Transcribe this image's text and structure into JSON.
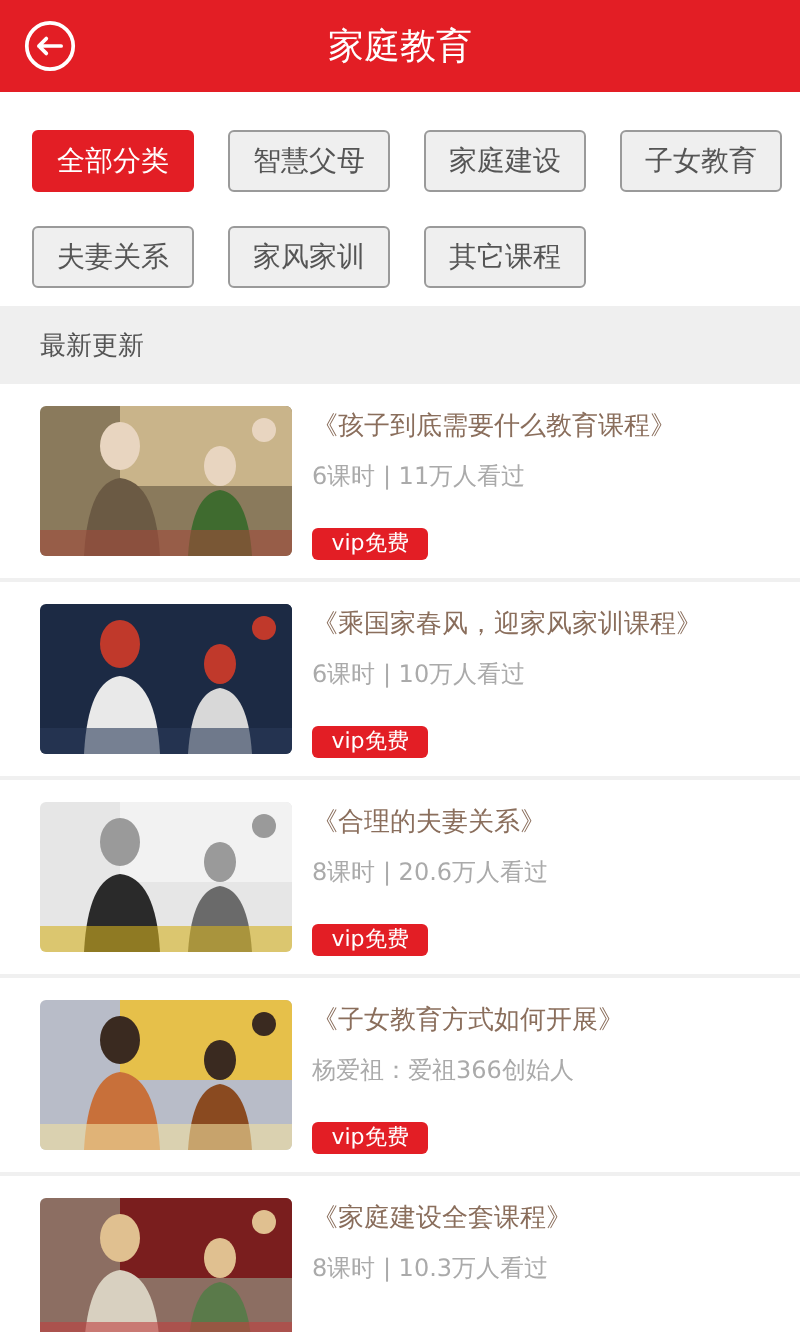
{
  "header": {
    "title": "家庭教育"
  },
  "categories": [
    {
      "label": "全部分类",
      "selected": true
    },
    {
      "label": "智慧父母",
      "selected": false
    },
    {
      "label": "家庭建设",
      "selected": false
    },
    {
      "label": "子女教育",
      "selected": false
    },
    {
      "label": "夫妻关系",
      "selected": false
    },
    {
      "label": "家风家训",
      "selected": false
    },
    {
      "label": "其它课程",
      "selected": false
    }
  ],
  "section": {
    "title": "最新更新"
  },
  "courses": [
    {
      "title": "《孩子到底需要什么教育课程》",
      "meta": "6课时 | 11万人看过",
      "badge": "vip免费"
    },
    {
      "title": "《乘国家春风，迎家风家训课程》",
      "meta": "6课时 | 10万人看过",
      "badge": "vip免费"
    },
    {
      "title": "《合理的夫妻关系》",
      "meta": "8课时 | 20.6万人看过",
      "badge": "vip免费"
    },
    {
      "title": "《子女教育方式如何开展》",
      "meta": "杨爱祖：爱祖366创始人",
      "badge": "vip免费"
    },
    {
      "title": "《家庭建设全套课程》",
      "meta": "8课时 | 10.3万人看过"
    }
  ]
}
